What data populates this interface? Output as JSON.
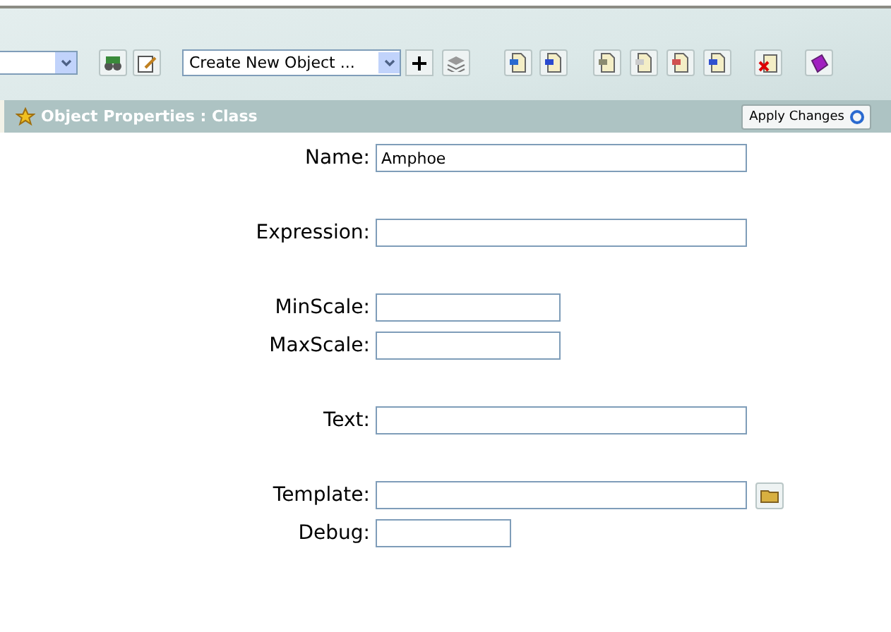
{
  "toolbar": {
    "combo": {
      "value": "Create New Object ..."
    }
  },
  "panel": {
    "title": "Object Properties : Class",
    "apply_button": "Apply Changes"
  },
  "field_groups": [
    [
      {
        "label": "Name:",
        "value": "Amphoe",
        "kind": "long"
      }
    ],
    [
      {
        "label": "Expression:",
        "kind": "long"
      }
    ],
    [
      {
        "label": "MinScale:",
        "kind": "short"
      },
      {
        "label": "MaxScale:",
        "kind": "short"
      }
    ],
    [
      {
        "label": "Text:",
        "kind": "long"
      }
    ],
    [
      {
        "label": "Template:",
        "kind": "browse"
      },
      {
        "label": "Debug:",
        "kind": "tiny"
      }
    ]
  ]
}
